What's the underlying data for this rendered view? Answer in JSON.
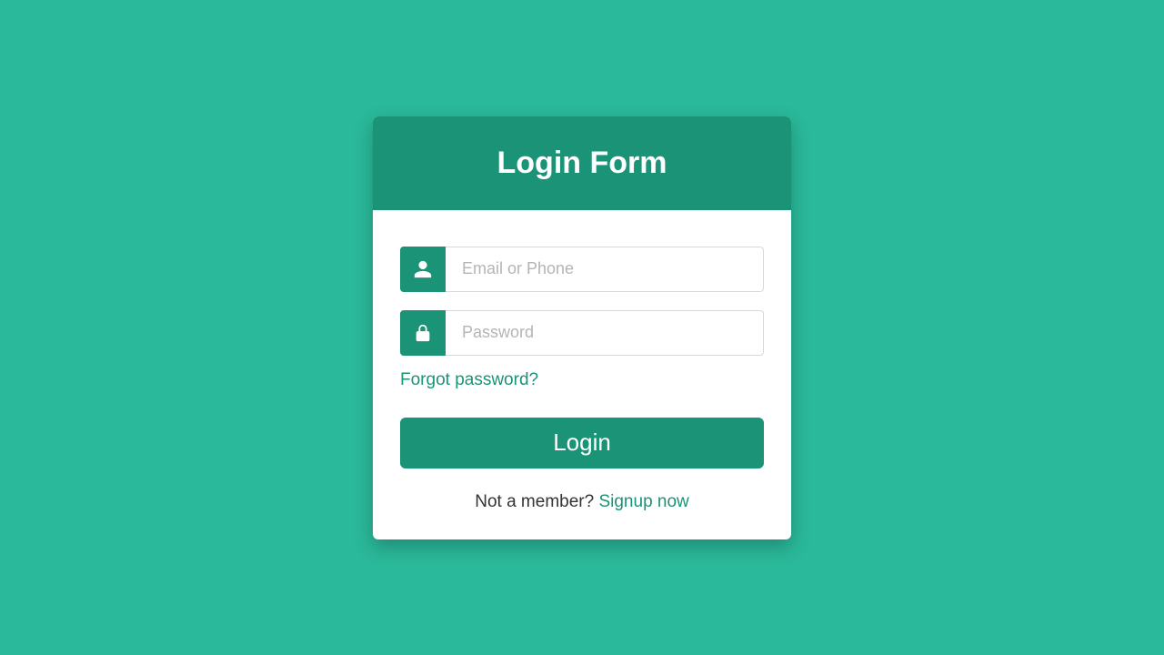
{
  "form": {
    "title": "Login Form",
    "email": {
      "placeholder": "Email or Phone",
      "value": ""
    },
    "password": {
      "placeholder": "Password",
      "value": ""
    },
    "forgot_label": "Forgot password?",
    "login_label": "Login",
    "footer_prefix": "Not a member? ",
    "signup_label": "Signup now"
  },
  "colors": {
    "background": "#2ab99a",
    "primary": "#1b9377"
  }
}
